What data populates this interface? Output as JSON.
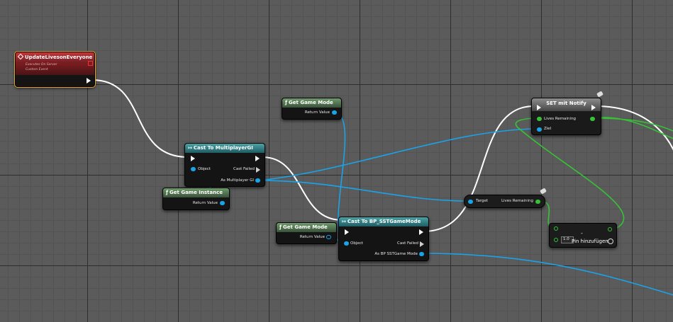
{
  "nodes": {
    "custom_event": {
      "title": "UpdateLivesonEveryone",
      "line1": "Executes On Server",
      "line2": "Custom Event"
    },
    "get_game_mode_top": {
      "title": "Get Game Mode",
      "return_label": "Return Value"
    },
    "cast_multiplayer": {
      "title": "Cast To MultiplayerGI",
      "object_label": "Object",
      "cast_failed_label": "Cast Failed",
      "as_label": "As Multiplayer GI"
    },
    "get_game_instance": {
      "title": "Get Game Instance",
      "return_label": "Return Value"
    },
    "get_game_mode_bottom": {
      "title": "Get Game Mode",
      "return_label": "Return Value"
    },
    "cast_sst": {
      "title": "Cast To BP_SSTGameMode",
      "object_label": "Object",
      "cast_failed_label": "Cast Failed",
      "as_label": "As BP SSTGame Mode"
    },
    "lives_getter": {
      "target_label": "Target",
      "lives_label": "Lives Remaining"
    },
    "set_notify": {
      "title": "SET mit Notify",
      "lives_label": "Lives Remaining",
      "target_label": "Ziel"
    },
    "subtract": {
      "operator": "-",
      "value": "1.0",
      "add_pin_label": "Pin hinzufügen"
    }
  },
  "icons": {
    "function": "f-icon",
    "cast": "cast-arrow-icon",
    "event": "event-diamond-icon",
    "add_pin": "plus-circle-icon"
  },
  "colors": {
    "exec_wire": "#ffffff",
    "object_wire": "#1aa3e8",
    "float_wire": "#36c236",
    "event_header": "#c4363b",
    "pure_header": "#6f9a6b",
    "cast_header": "#4aa3a6",
    "selection": "#e6a021"
  }
}
